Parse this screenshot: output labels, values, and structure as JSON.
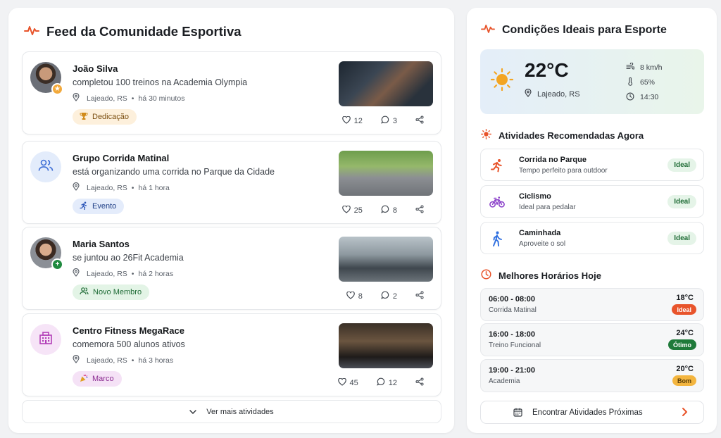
{
  "feed": {
    "title": "Feed da Comunidade Esportiva",
    "posts": [
      {
        "author": "João Silva",
        "action": "completou 100 treinos na Academia Olympia",
        "location": "Lajeado, RS",
        "time": "há 30 minutos",
        "tag": "Dedicação",
        "likes": "12",
        "comments": "3"
      },
      {
        "author": "Grupo Corrida Matinal",
        "action": "está organizando uma corrida no Parque da Cidade",
        "location": "Lajeado, RS",
        "time": "há 1 hora",
        "tag": "Evento",
        "likes": "25",
        "comments": "8"
      },
      {
        "author": "Maria Santos",
        "action": "se juntou ao 26Fit Academia",
        "location": "Lajeado, RS",
        "time": "há 2 horas",
        "tag": "Novo Membro",
        "likes": "8",
        "comments": "2"
      },
      {
        "author": "Centro Fitness MegaRace",
        "action": "comemora 500 alunos ativos",
        "location": "Lajeado, RS",
        "time": "há 3 horas",
        "tag": "Marco",
        "likes": "45",
        "comments": "12"
      }
    ],
    "more_label": "Ver mais atividades"
  },
  "sidebar": {
    "title": "Condições Ideais para Esporte",
    "weather": {
      "temperature": "22°C",
      "location": "Lajeado, RS",
      "wind": "8 km/h",
      "humidity": "65%",
      "time": "14:30"
    },
    "activities_title": "Atividades Recomendadas Agora",
    "activities": [
      {
        "name": "Corrida no Parque",
        "desc": "Tempo perfeito para outdoor",
        "status": "Ideal"
      },
      {
        "name": "Ciclismo",
        "desc": "Ideal para pedalar",
        "status": "Ideal"
      },
      {
        "name": "Caminhada",
        "desc": "Aproveite o sol",
        "status": "Ideal"
      }
    ],
    "hours_title": "Melhores Horários Hoje",
    "hours": [
      {
        "range": "06:00 - 08:00",
        "name": "Corrida Matinal",
        "temp": "18°C",
        "status": "Ideal"
      },
      {
        "range": "16:00 - 18:00",
        "name": "Treino Funcional",
        "temp": "24°C",
        "status": "Ótimo"
      },
      {
        "range": "19:00 - 21:00",
        "name": "Academia",
        "temp": "20°C",
        "status": "Bom"
      }
    ],
    "find_label": "Encontrar Atividades Próximas"
  },
  "colors": {
    "accent": "#e8542b",
    "ideal_badge": "#e8542b",
    "otimo_badge": "#1f7a3a",
    "bom_badge": "#f3b53f"
  }
}
